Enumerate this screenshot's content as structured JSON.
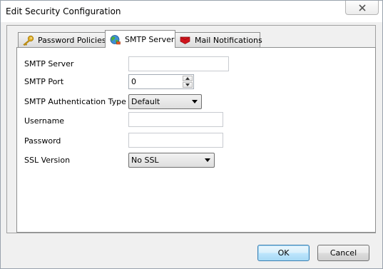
{
  "window": {
    "title": "Edit Security Configuration"
  },
  "tabs": [
    {
      "label": "Password Policies",
      "icon": "key-icon",
      "active": false
    },
    {
      "label": "SMTP Server",
      "icon": "globe-icon",
      "active": true
    },
    {
      "label": "Mail Notifications",
      "icon": "flag-icon",
      "active": false
    }
  ],
  "form": {
    "smtp_server": {
      "label": "SMTP Server",
      "value": ""
    },
    "smtp_port": {
      "label": "SMTP Port",
      "value": "0"
    },
    "auth_type": {
      "label": "SMTP Authentication Type",
      "selected": "Default"
    },
    "username": {
      "label": "Username",
      "value": ""
    },
    "password": {
      "label": "Password",
      "value": ""
    },
    "ssl_version": {
      "label": "SSL Version",
      "selected": "No SSL"
    }
  },
  "buttons": {
    "ok": "OK",
    "cancel": "Cancel"
  },
  "colors": {
    "tab_flag": "#d0141c",
    "key_gold": "#d8a31a",
    "default_button_border": "#3c7fb1"
  }
}
